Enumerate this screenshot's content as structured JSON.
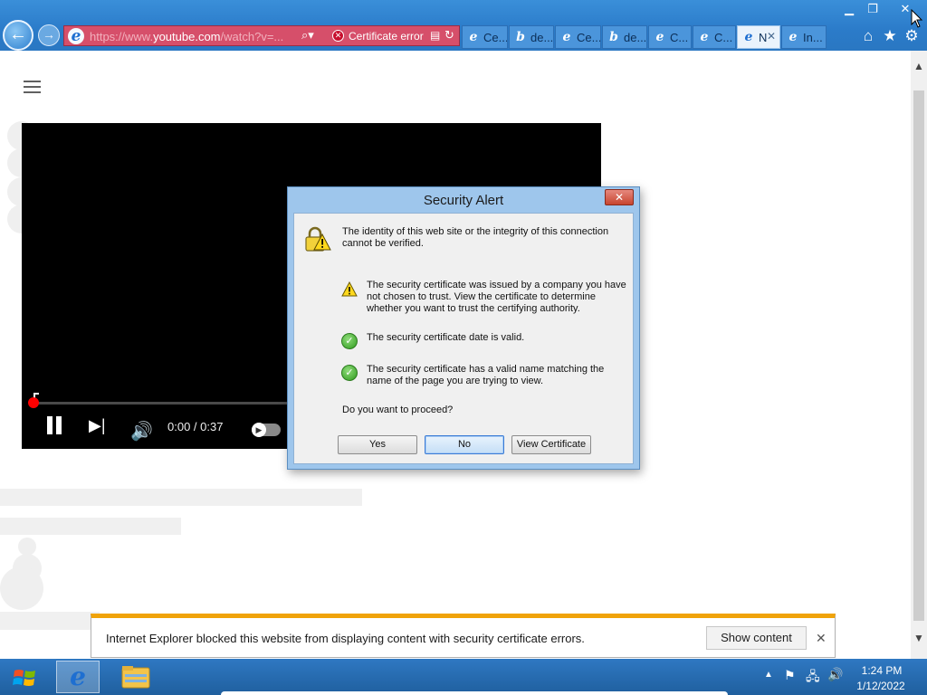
{
  "browser": {
    "window_controls": {
      "minimize": "▁",
      "maximize": "❐",
      "close": "✕"
    },
    "nav": {
      "back": "←",
      "forward": "→"
    },
    "address": {
      "url_prefix": "https://www.",
      "url_domain": "youtube.com",
      "url_suffix": "/watch?v=...",
      "search_glyph": "⌕▾",
      "error_label": "Certificate error",
      "error_glyph": "✕",
      "refresh_glyph": "↻",
      "cert_glyph": "▤"
    },
    "tabs": [
      {
        "label": "Ce...",
        "icon": "ie-icon"
      },
      {
        "label": "de...",
        "icon": "bing-icon"
      },
      {
        "label": "Ce...",
        "icon": "ie-icon"
      },
      {
        "label": "de...",
        "icon": "bing-icon"
      },
      {
        "label": "C...",
        "icon": "ie-icon"
      },
      {
        "label": "C...",
        "icon": "ie-icon"
      },
      {
        "label": "N",
        "icon": "ie-icon",
        "active": true,
        "close": "✕"
      },
      {
        "label": "In...",
        "icon": "ie-icon"
      }
    ],
    "toolbar": {
      "home": "⌂",
      "favorites": "★",
      "settings": "⚙"
    }
  },
  "page": {
    "player": {
      "time": "0:00 / 0:37",
      "next_glyph": "▶|",
      "volume_glyph": "🔊",
      "autoplay_glyph": "▶",
      "progress_fraction": 0.0
    },
    "scrollbar": {
      "up": "▲",
      "down": "▼"
    }
  },
  "notification": {
    "text": "Internet Explorer blocked this website from displaying content with security certificate errors.",
    "button": "Show content",
    "close": "✕"
  },
  "dialog": {
    "title": "Security Alert",
    "close": "✕",
    "intro": "The identity of this web site or the integrity of this connection cannot be verified.",
    "items": [
      {
        "status": "warning",
        "text": "The security certificate was issued by a company you have not chosen to trust. View the certificate to determine whether you want to trust the certifying authority."
      },
      {
        "status": "ok",
        "text": "The security certificate date is valid."
      },
      {
        "status": "ok",
        "text": "The security certificate has a valid name matching the name of the page you are trying to view."
      }
    ],
    "question": "Do you want to proceed?",
    "buttons": {
      "yes": "Yes",
      "no": "No",
      "view_certificate": "View Certificate"
    }
  },
  "taskbar": {
    "ie_glyph": "e",
    "tray_arrow": "▲",
    "tray_flag": "⚑",
    "tray_net": "🖧",
    "tray_volume": "🔊",
    "time": "1:24 PM",
    "date": "1/12/2022"
  },
  "colors": {
    "title_bar": "#2b7bc9",
    "address_error": "#d64f6a",
    "notification_accent": "#f0a30a",
    "dialog_frame": "#9ec6ec",
    "taskbar": "#1f5f9e"
  }
}
